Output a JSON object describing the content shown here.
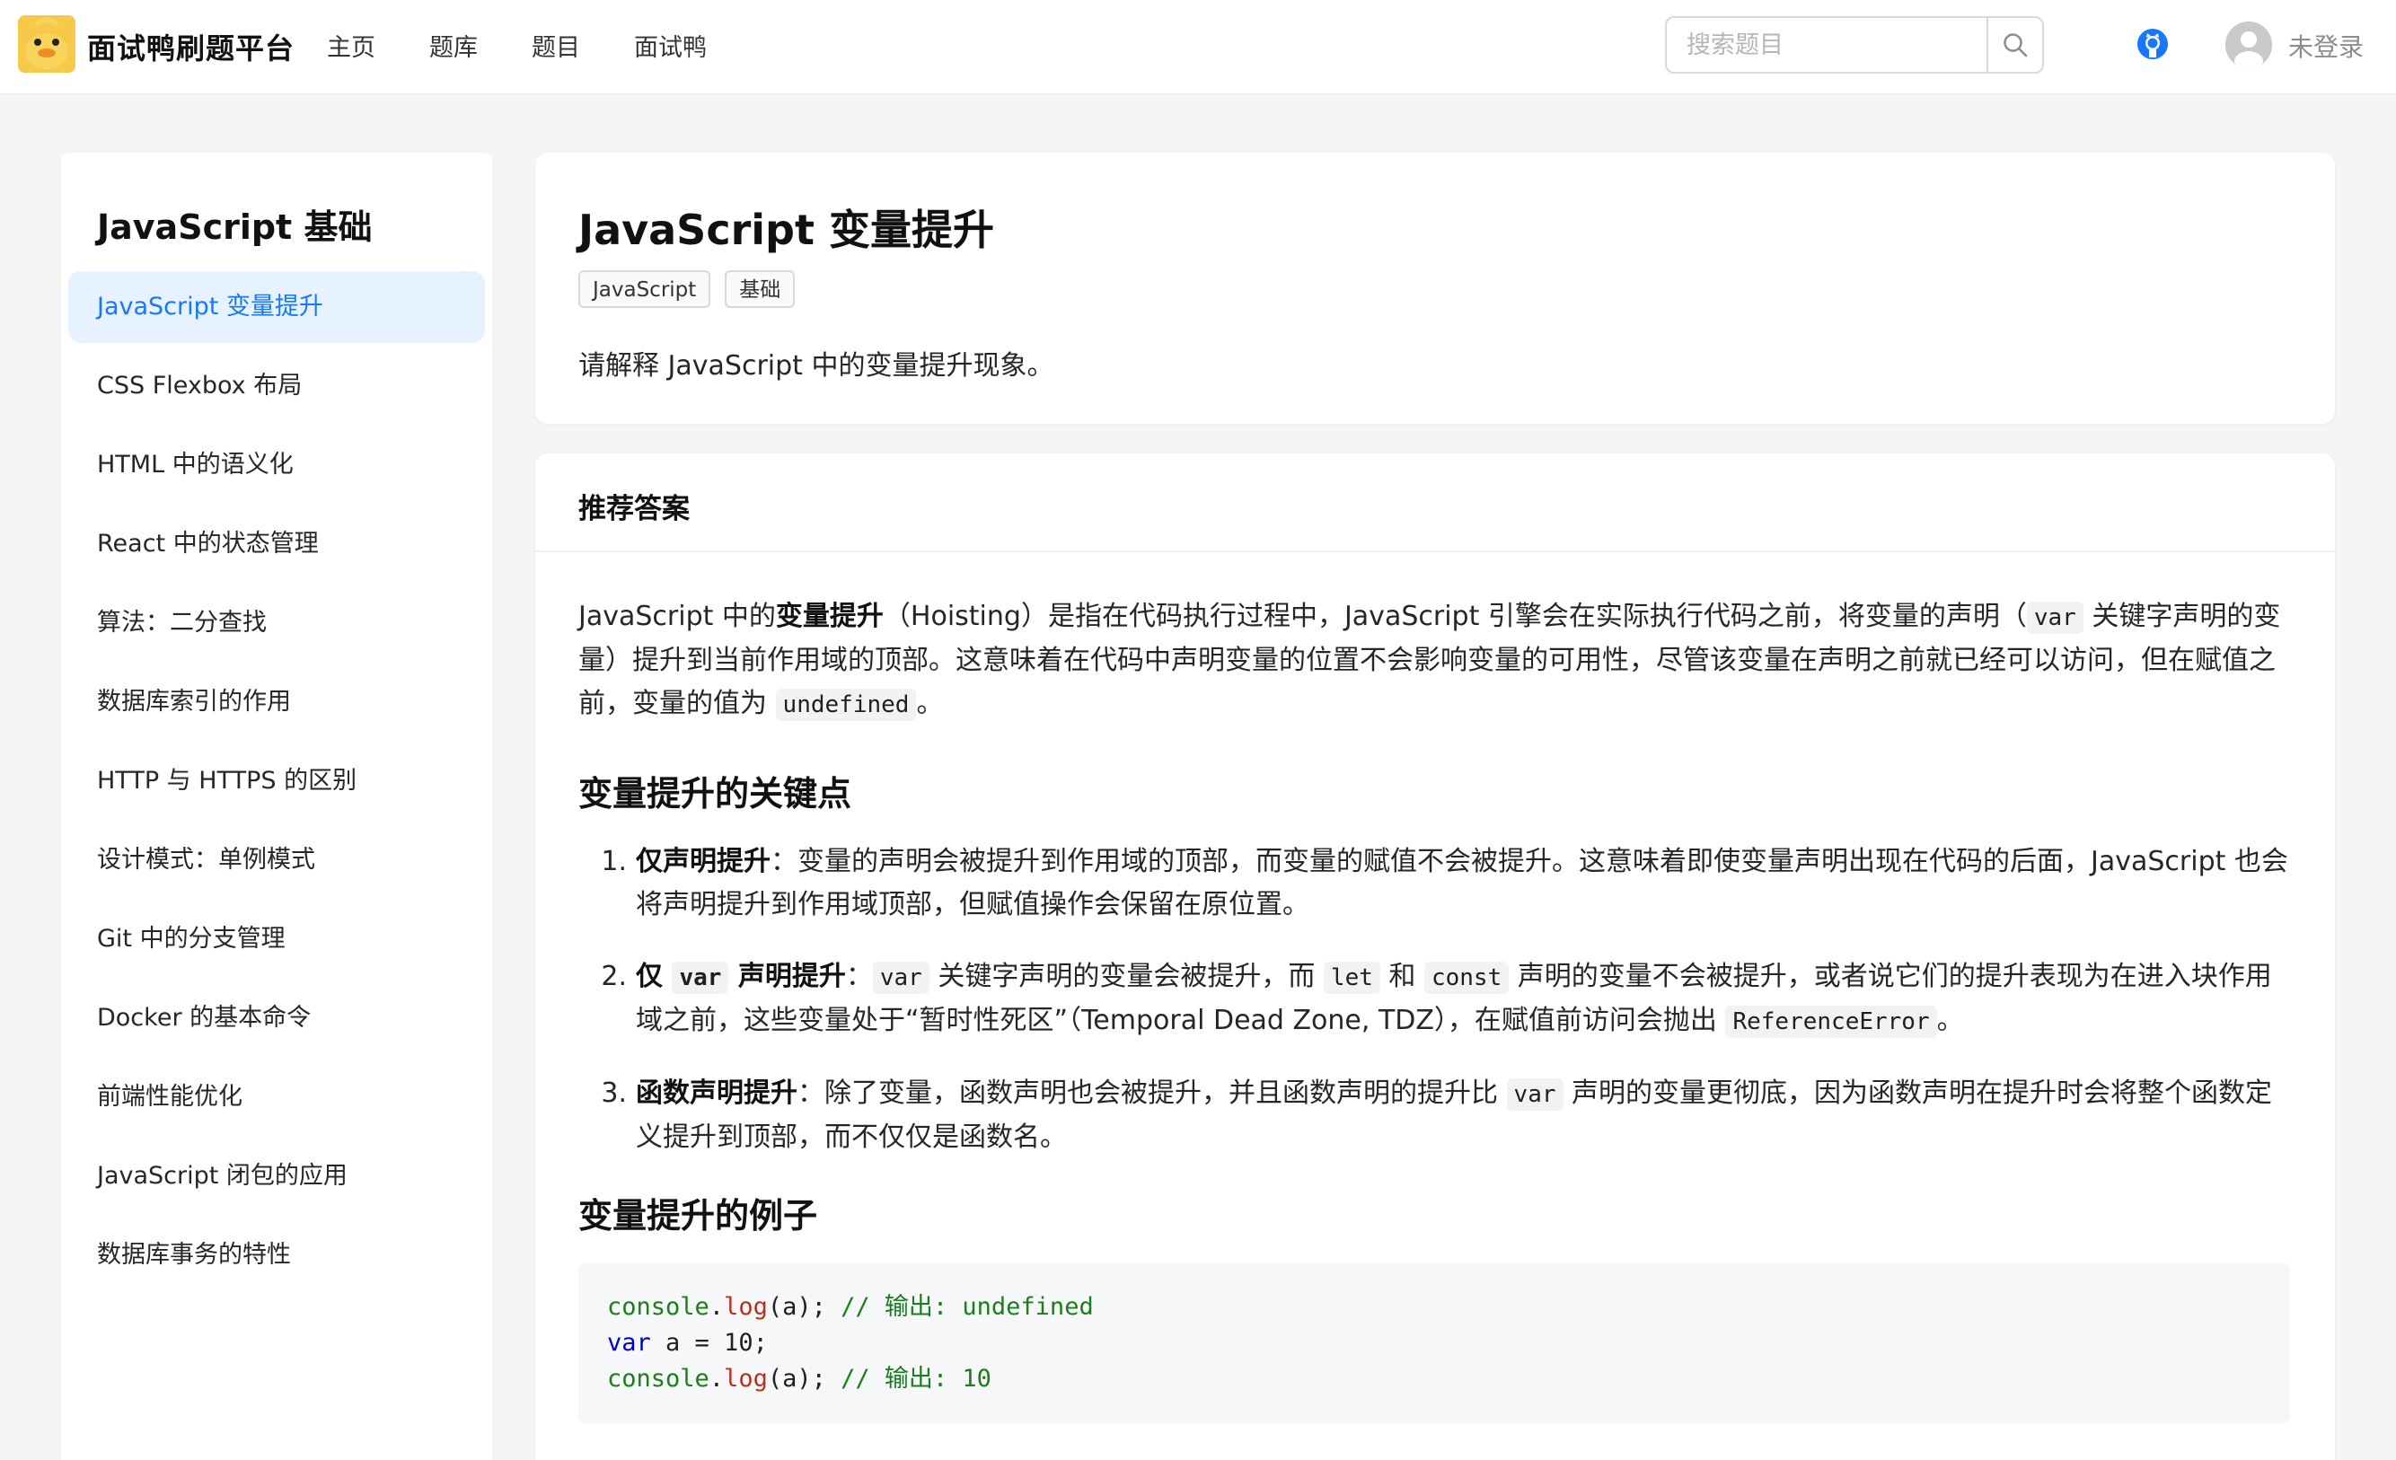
{
  "header": {
    "brand": "面试鸭刷题平台",
    "nav": [
      "主页",
      "题库",
      "题目",
      "面试鸭"
    ],
    "search_placeholder": "搜索题目",
    "login_label": "未登录"
  },
  "sidebar": {
    "title": "JavaScript 基础",
    "items": [
      {
        "label": "JavaScript 变量提升",
        "active": true
      },
      {
        "label": "CSS Flexbox 布局"
      },
      {
        "label": "HTML 中的语义化"
      },
      {
        "label": "React 中的状态管理"
      },
      {
        "label": "算法：二分查找"
      },
      {
        "label": "数据库索引的作用"
      },
      {
        "label": "HTTP 与 HTTPS 的区别"
      },
      {
        "label": "设计模式：单例模式"
      },
      {
        "label": "Git 中的分支管理"
      },
      {
        "label": "Docker 的基本命令"
      },
      {
        "label": "前端性能优化"
      },
      {
        "label": "JavaScript 闭包的应用"
      },
      {
        "label": "数据库事务的特性"
      }
    ]
  },
  "question": {
    "title": "JavaScript 变量提升",
    "tags": [
      "JavaScript",
      "基础"
    ],
    "description": "请解释 JavaScript 中的变量提升现象。"
  },
  "answer": {
    "heading": "推荐答案",
    "intro": {
      "p1": "JavaScript 中的",
      "b1": "变量提升",
      "p2": "（Hoisting）是指在代码执行过程中，JavaScript 引擎会在实际执行代码之前，将变量的声明（",
      "c1": "var",
      "p3": " 关键字声明的变量）提升到当前作用域的顶部。这意味着在代码中声明变量的位置不会影响变量的可用性，尽管该变量在声明之前就已经可以访问，但在赋值之前，变量的值为 ",
      "c2": "undefined",
      "p4": "。"
    },
    "section1": "变量提升的关键点",
    "points": [
      {
        "num": "1.",
        "bold": "仅声明提升",
        "text": "：变量的声明会被提升到作用域的顶部，而变量的赋值不会被提升。这意味着即使变量声明出现在代码的后面，JavaScript 也会将声明提升到作用域顶部，但赋值操作会保留在原位置。"
      },
      {
        "num": "2.",
        "bold_a": "仅 ",
        "bold_code": "var",
        "bold_b": " 声明提升",
        "t1": "：",
        "c1": "var",
        "t2": " 关键字声明的变量会被提升，而 ",
        "c2": "let",
        "t3": " 和 ",
        "c3": "const",
        "t4": " 声明的变量不会被提升，或者说它们的提升表现为在进入块作用域之前，这些变量处于“暂时性死区”（Temporal Dead Zone, TDZ），在赋值前访问会抛出 ",
        "c4": "ReferenceError",
        "t5": "。"
      },
      {
        "num": "3.",
        "bold": "函数声明提升",
        "t1": "：除了变量，函数声明也会被提升，并且函数声明的提升比 ",
        "c1": "var",
        "t2": " 声明的变量更彻底，因为函数声明在提升时会将整个函数定义提升到顶部，而不仅仅是函数名。"
      }
    ],
    "section2": "变量提升的例子",
    "code": {
      "l1_obj": "console",
      "l1_dot": ".",
      "l1_fn": "log",
      "l1_rest": "(a); ",
      "l1_cm": "// 输出: undefined",
      "l2_kw": "var",
      "l2_rest": " a = 10;",
      "l3_obj": "console",
      "l3_dot": ".",
      "l3_fn": "log",
      "l3_rest": "(a); ",
      "l3_cm": "// 输出: 10"
    }
  }
}
